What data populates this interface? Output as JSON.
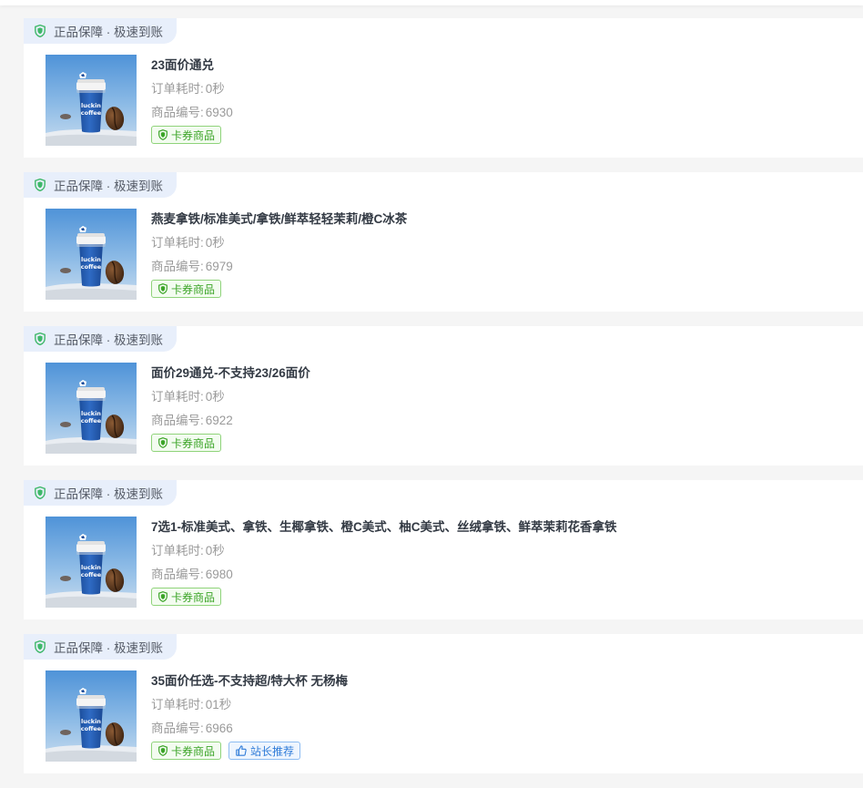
{
  "colors": {
    "page_bg": "#f5f5f5",
    "card_bg": "#ffffff",
    "tag_bg": "#e8effb",
    "shield_green": "#3fb86a",
    "badge_green": "#3ba427",
    "badge_blue": "#2e7bd8",
    "title_text": "#333a44",
    "meta_text": "#9a9a9a"
  },
  "labels": {
    "order_time_prefix": "订单耗时:",
    "product_id_prefix": "商品编号:"
  },
  "products": [
    {
      "tag": "正品保障 · 极速到账",
      "tag_icon": "shield-icon",
      "image": "luckin-coffee-cup",
      "image_text": [
        "luckin",
        "coffee"
      ],
      "title": "23面价通兑",
      "order_time": "0秒",
      "product_id": "6930",
      "badges": [
        {
          "label": "卡券商品",
          "icon": "shield-icon",
          "style": "green"
        }
      ]
    },
    {
      "tag": "正品保障 · 极速到账",
      "tag_icon": "shield-icon",
      "image": "luckin-coffee-cup",
      "image_text": [
        "luckin",
        "coffee"
      ],
      "title": "燕麦拿铁/标准美式/拿铁/鲜萃轻轻茉莉/橙C冰茶",
      "order_time": "0秒",
      "product_id": "6979",
      "badges": [
        {
          "label": "卡券商品",
          "icon": "shield-icon",
          "style": "green"
        }
      ]
    },
    {
      "tag": "正品保障 · 极速到账",
      "tag_icon": "shield-icon",
      "image": "luckin-coffee-cup",
      "image_text": [
        "luckin",
        "coffee"
      ],
      "title": "面价29通兑-不支持23/26面价",
      "order_time": "0秒",
      "product_id": "6922",
      "badges": [
        {
          "label": "卡券商品",
          "icon": "shield-icon",
          "style": "green"
        }
      ]
    },
    {
      "tag": "正品保障 · 极速到账",
      "tag_icon": "shield-icon",
      "image": "luckin-coffee-cup",
      "image_text": [
        "luckin",
        "coffee"
      ],
      "title": "7选1-标准美式、拿铁、生椰拿铁、橙C美式、柚C美式、丝绒拿铁、鲜萃茉莉花香拿铁",
      "order_time": "0秒",
      "product_id": "6980",
      "badges": [
        {
          "label": "卡券商品",
          "icon": "shield-icon",
          "style": "green"
        }
      ]
    },
    {
      "tag": "正品保障 · 极速到账",
      "tag_icon": "shield-icon",
      "image": "luckin-coffee-cup",
      "image_text": [
        "luckin",
        "coffee"
      ],
      "title": "35面价任选-不支持超/特大杯 无杨梅",
      "order_time": "01秒",
      "product_id": "6966",
      "badges": [
        {
          "label": "卡券商品",
          "icon": "shield-icon",
          "style": "green"
        },
        {
          "label": "站长推荐",
          "icon": "thumbs-up-icon",
          "style": "blue"
        }
      ]
    }
  ]
}
